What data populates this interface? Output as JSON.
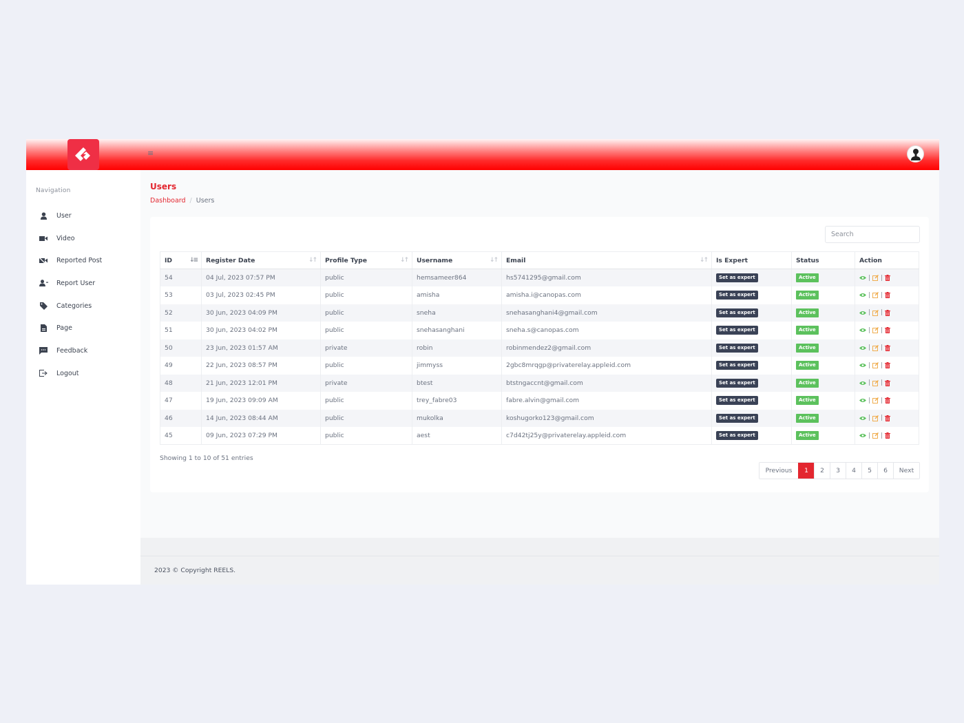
{
  "header": {
    "logo_icon": "diamond-logo-icon",
    "menu_icon": "hamburger-icon",
    "avatar_icon": "user-avatar-icon",
    "brand_color": "#ef2f45"
  },
  "sidebar": {
    "title": "Navigation",
    "items": [
      {
        "label": "User",
        "icon": "user-icon"
      },
      {
        "label": "Video",
        "icon": "video-icon"
      },
      {
        "label": "Reported Post",
        "icon": "video-slash-icon"
      },
      {
        "label": "Report User",
        "icon": "user-plus-icon"
      },
      {
        "label": "Categories",
        "icon": "tags-icon"
      },
      {
        "label": "Page",
        "icon": "file-icon"
      },
      {
        "label": "Feedback",
        "icon": "comment-icon"
      },
      {
        "label": "Logout",
        "icon": "logout-icon"
      }
    ]
  },
  "page": {
    "title": "Users",
    "breadcrumb": {
      "home": "Dashboard",
      "separator": "/",
      "current": "Users"
    }
  },
  "table": {
    "search_placeholder": "Search",
    "columns": [
      "ID",
      "Register Date",
      "Profile Type",
      "Username",
      "Email",
      "Is Expert",
      "Status",
      "Action"
    ],
    "rows": [
      {
        "id": "54",
        "date": "04 Jul, 2023 07:57 PM",
        "type": "public",
        "username": "hemsameer864",
        "email": "hs5741295@gmail.com",
        "expert": "Set as expert",
        "status": "Active"
      },
      {
        "id": "53",
        "date": "03 Jul, 2023 02:45 PM",
        "type": "public",
        "username": "amisha",
        "email": "amisha.i@canopas.com",
        "expert": "Set as expert",
        "status": "Active"
      },
      {
        "id": "52",
        "date": "30 Jun, 2023 04:09 PM",
        "type": "public",
        "username": "sneha",
        "email": "snehasanghani4@gmail.com",
        "expert": "Set as expert",
        "status": "Active"
      },
      {
        "id": "51",
        "date": "30 Jun, 2023 04:02 PM",
        "type": "public",
        "username": "snehasanghani",
        "email": "sneha.s@canopas.com",
        "expert": "Set as expert",
        "status": "Active"
      },
      {
        "id": "50",
        "date": "23 Jun, 2023 01:57 AM",
        "type": "private",
        "username": "robin",
        "email": "robinmendez2@gmail.com",
        "expert": "Set as expert",
        "status": "Active"
      },
      {
        "id": "49",
        "date": "22 Jun, 2023 08:57 PM",
        "type": "public",
        "username": "jimmyss",
        "email": "2gbc8mrqgp@privaterelay.appleid.com",
        "expert": "Set as expert",
        "status": "Active"
      },
      {
        "id": "48",
        "date": "21 Jun, 2023 12:01 PM",
        "type": "private",
        "username": "btest",
        "email": "btstngaccnt@gmail.com",
        "expert": "Set as expert",
        "status": "Active"
      },
      {
        "id": "47",
        "date": "19 Jun, 2023 09:09 AM",
        "type": "public",
        "username": "trey_fabre03",
        "email": "fabre.alvin@gmail.com",
        "expert": "Set as expert",
        "status": "Active"
      },
      {
        "id": "46",
        "date": "14 Jun, 2023 08:44 AM",
        "type": "public",
        "username": "mukolka",
        "email": "koshugorko123@gmail.com",
        "expert": "Set as expert",
        "status": "Active"
      },
      {
        "id": "45",
        "date": "09 Jun, 2023 07:29 PM",
        "type": "public",
        "username": "aest",
        "email": "c7d42tj25y@privaterelay.appleid.com",
        "expert": "Set as expert",
        "status": "Active"
      }
    ],
    "action_icons": [
      "eye-icon",
      "edit-icon",
      "trash-icon"
    ],
    "action_separator": "|",
    "info": "Showing 1 to 10 of 51 entries",
    "pagination": {
      "previous": "Previous",
      "pages": [
        "1",
        "2",
        "3",
        "4",
        "5",
        "6"
      ],
      "current": "1",
      "next": "Next"
    }
  },
  "footer": {
    "text": "2023 © Copyright REELS."
  },
  "colors": {
    "accent": "#e3262f",
    "expert_button": "#3a4256",
    "active_badge": "#5cc15d",
    "view_icon": "#5cc15d",
    "edit_icon": "#f0ad4e",
    "delete_icon": "#e3262f"
  }
}
